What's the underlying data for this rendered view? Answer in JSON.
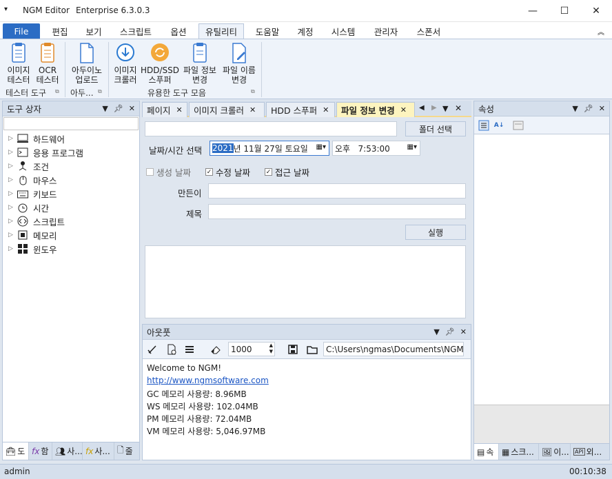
{
  "titlebar": {
    "app": "NGM Editor",
    "edition": "Enterprise 6.3.0.3"
  },
  "menu": {
    "items": [
      {
        "label": "File"
      },
      {
        "label": "편집"
      },
      {
        "label": "보기"
      },
      {
        "label": "스크립트"
      },
      {
        "label": "옵션"
      },
      {
        "label": "유틸리티"
      },
      {
        "label": "도움말"
      },
      {
        "label": "계정"
      },
      {
        "label": "시스템"
      },
      {
        "label": "관리자"
      },
      {
        "label": "스폰서"
      }
    ]
  },
  "ribbon": {
    "groups": [
      {
        "label": "테스터 도구",
        "buttons": [
          "이미지\n테스터",
          "OCR\n테스터"
        ]
      },
      {
        "label": "아두...",
        "buttons": [
          "아두이노\n업로드"
        ]
      },
      {
        "label": "유용한 도구 모음",
        "buttons": [
          "이미지\n크롤러",
          "HDD/SSD\n스푸퍼",
          "파일 정보\n변경",
          "파일 이름\n변경"
        ]
      }
    ]
  },
  "left_panel": {
    "title": "도구 상자",
    "tree": [
      "하드웨어",
      "응용 프로그램",
      "조건",
      "마우스",
      "키보드",
      "시간",
      "스크립트",
      "메모리",
      "윈도우"
    ],
    "bottom_tabs": [
      "도",
      "함",
      "사...",
      "사...",
      "줄"
    ]
  },
  "doc_tabs": [
    "페이지",
    "이미지 크롤러",
    "HDD 스푸퍼",
    "파일 정보 변경"
  ],
  "file_info": {
    "path_value": "",
    "folder_button": "폴더 선택",
    "datetime_label": "날짜/시간 선택",
    "date_year": "2021",
    "date_rest": "년 11월 27일 토요일",
    "time_value": "오후   7:53:00",
    "checks": [
      {
        "label": "생성 날짜",
        "checked": false
      },
      {
        "label": "수정 날짜",
        "checked": true
      },
      {
        "label": "접근 날짜",
        "checked": true
      }
    ],
    "author_label": "만든이",
    "title_label": "제목",
    "run_button": "실행"
  },
  "output": {
    "title": "아웃풋",
    "count": "1000",
    "path": "C:\\Users\\ngmas\\Documents\\NGM6\\",
    "lines": [
      "Welcome to NGM!",
      "http://www.ngmsoftware.com",
      "GC 메모리 사용량: 8.96MB",
      "WS 메모리 사용량: 102.04MB",
      "PM 메모리 사용량: 72.04MB",
      "VM 메모리 사용량: 5,046.97MB"
    ]
  },
  "right_panel": {
    "title": "속성",
    "bottom_tabs": [
      "속",
      "스크...",
      "이...",
      "외..."
    ]
  },
  "status": {
    "user": "admin",
    "clock": "00:10:38"
  }
}
